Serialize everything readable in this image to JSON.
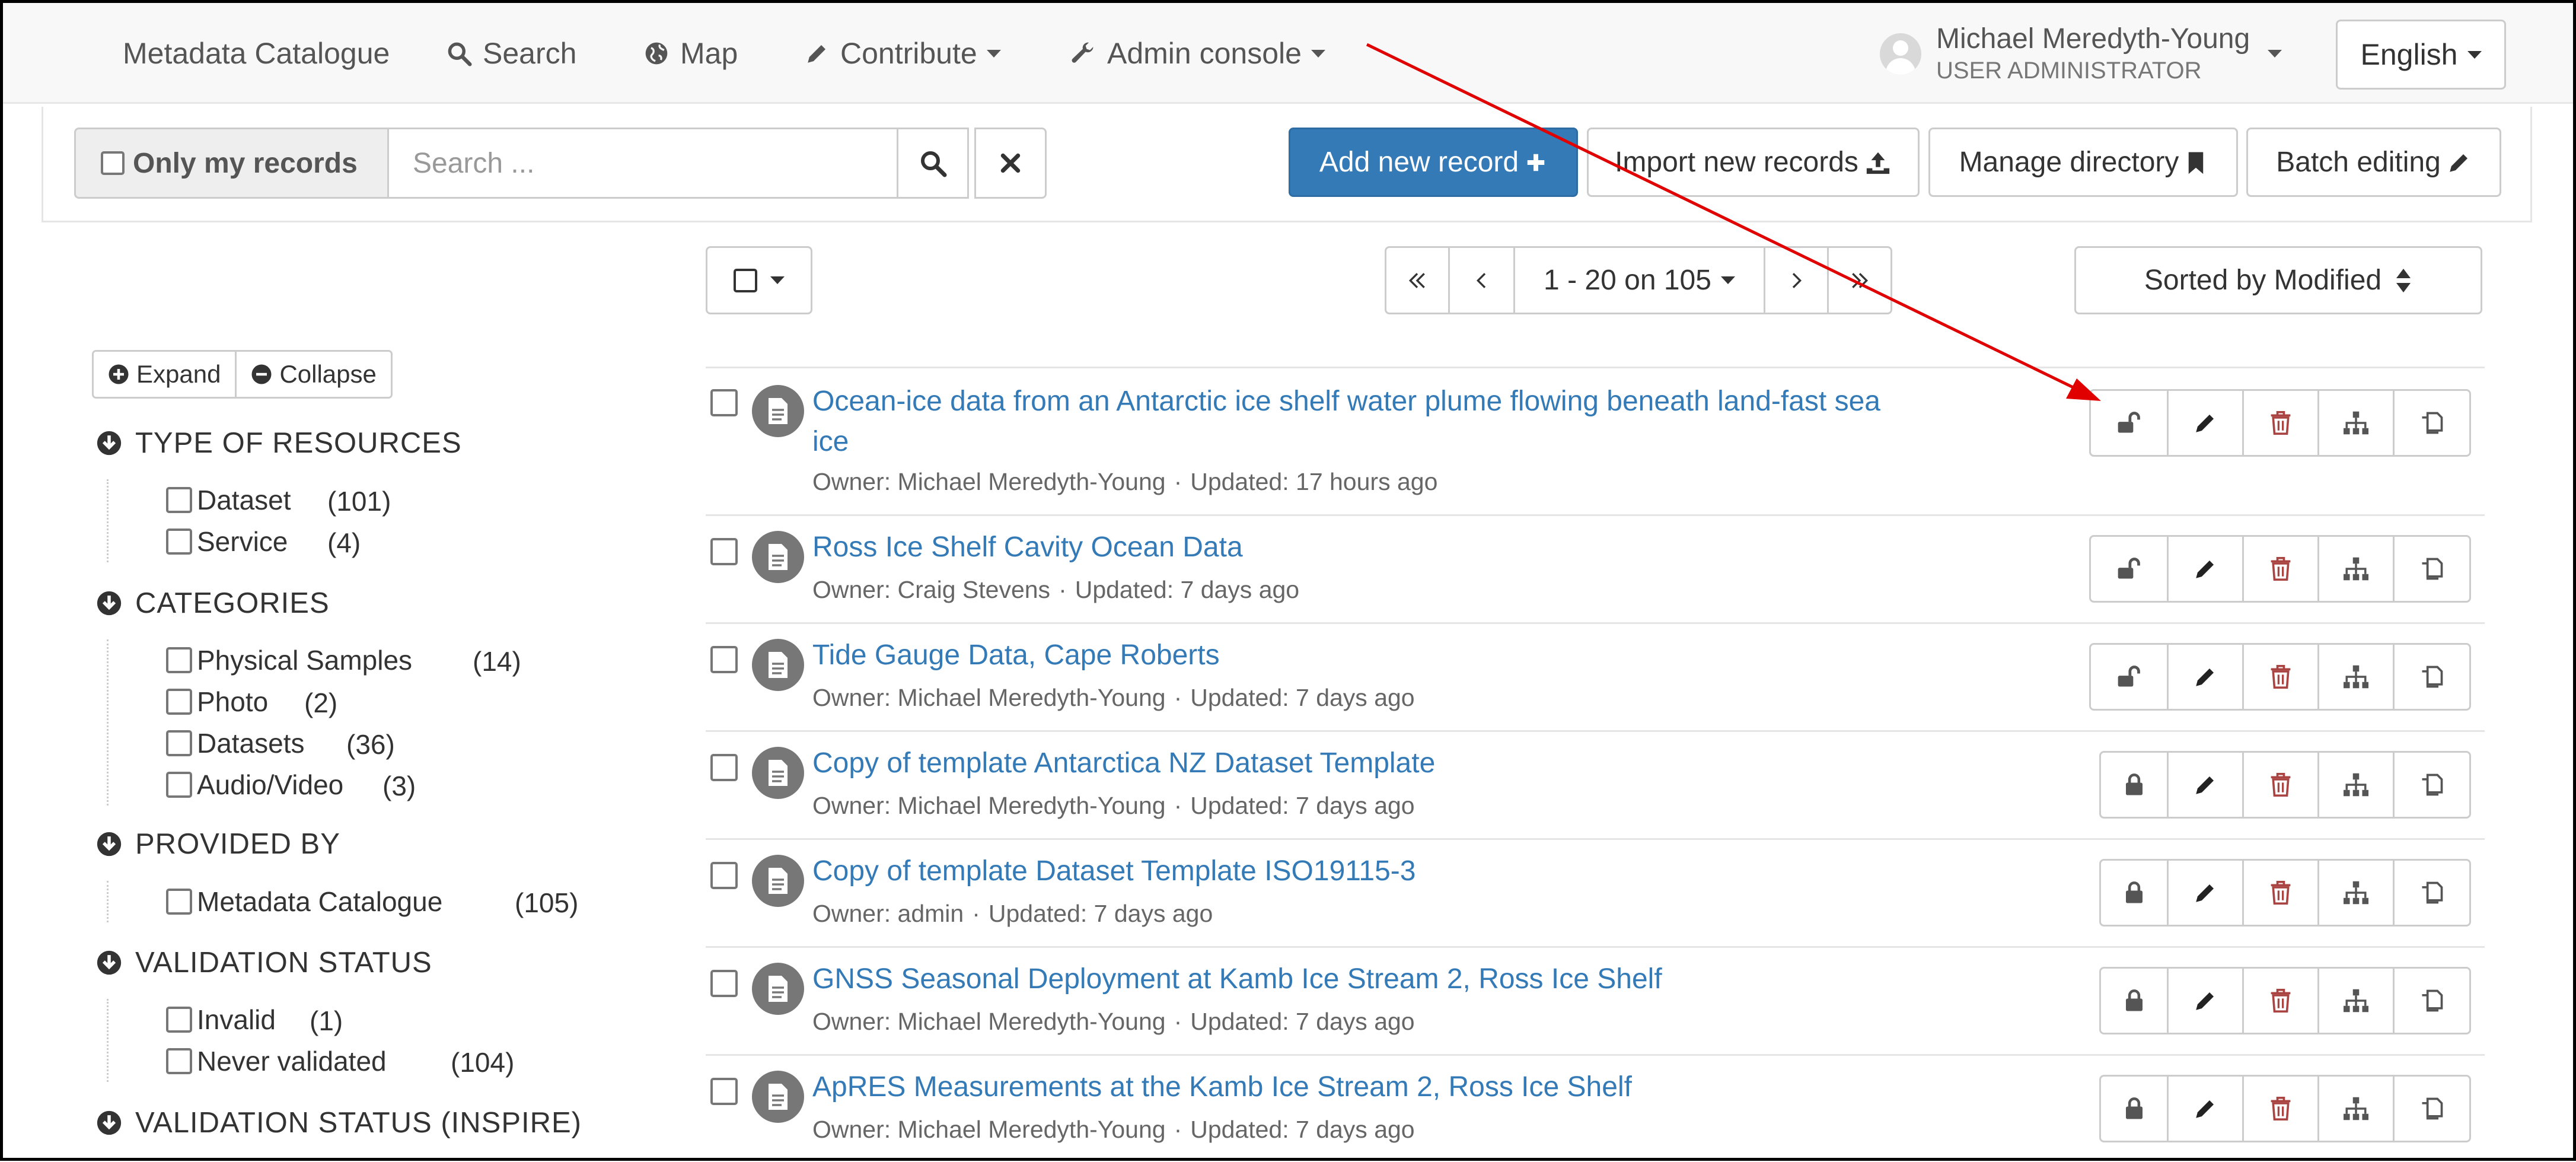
{
  "navbar": {
    "items": [
      {
        "label": "Metadata Catalogue",
        "icon": ""
      },
      {
        "label": "Search",
        "icon": "search-icon"
      },
      {
        "label": "Map",
        "icon": "globe-icon"
      },
      {
        "label": "Contribute",
        "icon": "pencil-icon"
      },
      {
        "label": "Admin console",
        "icon": "wrench-icon"
      }
    ],
    "user": {
      "name": "Michael Meredyth-Young",
      "role": "USER ADMINISTRATOR"
    },
    "language": "English"
  },
  "toolbar": {
    "only_my_records": "Only my records",
    "search_placeholder": "Search ...",
    "add_new_record": "Add new record",
    "import_new_records": "Import new records",
    "manage_directory": "Manage directory",
    "batch_editing": "Batch editing"
  },
  "pagination": {
    "range": "1 - 20 on 105",
    "sort": "Sorted by Modified"
  },
  "facets": {
    "expand": "Expand",
    "collapse": "Collapse",
    "groups": [
      {
        "title": "TYPE OF RESOURCES",
        "items": [
          {
            "label": "Dataset",
            "count": "(101)"
          },
          {
            "label": "Service",
            "count": "(4)"
          }
        ]
      },
      {
        "title": "CATEGORIES",
        "items": [
          {
            "label": "Physical Samples",
            "count": "(14)"
          },
          {
            "label": "Photo",
            "count": "(2)"
          },
          {
            "label": "Datasets",
            "count": "(36)"
          },
          {
            "label": "Audio/Video",
            "count": "(3)"
          }
        ]
      },
      {
        "title": "PROVIDED BY",
        "items": [
          {
            "label": "Metadata Catalogue",
            "count": "(105)"
          }
        ]
      },
      {
        "title": "VALIDATION STATUS",
        "items": [
          {
            "label": "Invalid",
            "count": "(1)"
          },
          {
            "label": "Never validated",
            "count": "(104)"
          }
        ]
      },
      {
        "title": "VALIDATION STATUS (INSPIRE)",
        "items": []
      }
    ]
  },
  "results": [
    {
      "title": "Ocean-ice data from an Antarctic ice shelf water plume flowing beneath land-fast sea ice",
      "owner": "Owner: Michael Meredyth-Young",
      "updated": "Updated: 17 hours ago",
      "lock": "unlocked"
    },
    {
      "title": "Ross Ice Shelf Cavity Ocean Data",
      "owner": "Owner: Craig Stevens",
      "updated": "Updated: 7 days ago",
      "lock": "unlocked"
    },
    {
      "title": "Tide Gauge Data, Cape Roberts",
      "owner": "Owner: Michael Meredyth-Young",
      "updated": "Updated: 7 days ago",
      "lock": "unlocked"
    },
    {
      "title": "Copy of template Antarctica NZ Dataset Template",
      "owner": "Owner: Michael Meredyth-Young",
      "updated": "Updated: 7 days ago",
      "lock": "locked"
    },
    {
      "title": "Copy of template Dataset Template ISO19115-3",
      "owner": "Owner: admin",
      "updated": "Updated: 7 days ago",
      "lock": "locked"
    },
    {
      "title": "GNSS Seasonal Deployment at Kamb Ice Stream 2, Ross Ice Shelf",
      "owner": "Owner: Michael Meredyth-Young",
      "updated": "Updated: 7 days ago",
      "lock": "locked"
    },
    {
      "title": "ApRES Measurements at the Kamb Ice Stream 2, Ross Ice Shelf",
      "owner": "Owner: Michael Meredyth-Young",
      "updated": "Updated: 7 days ago",
      "lock": "locked"
    }
  ],
  "colors": {
    "primary": "#337ab7",
    "link": "#337ab7",
    "delete": "#a94442",
    "annotation_arrow": "#e00000"
  }
}
